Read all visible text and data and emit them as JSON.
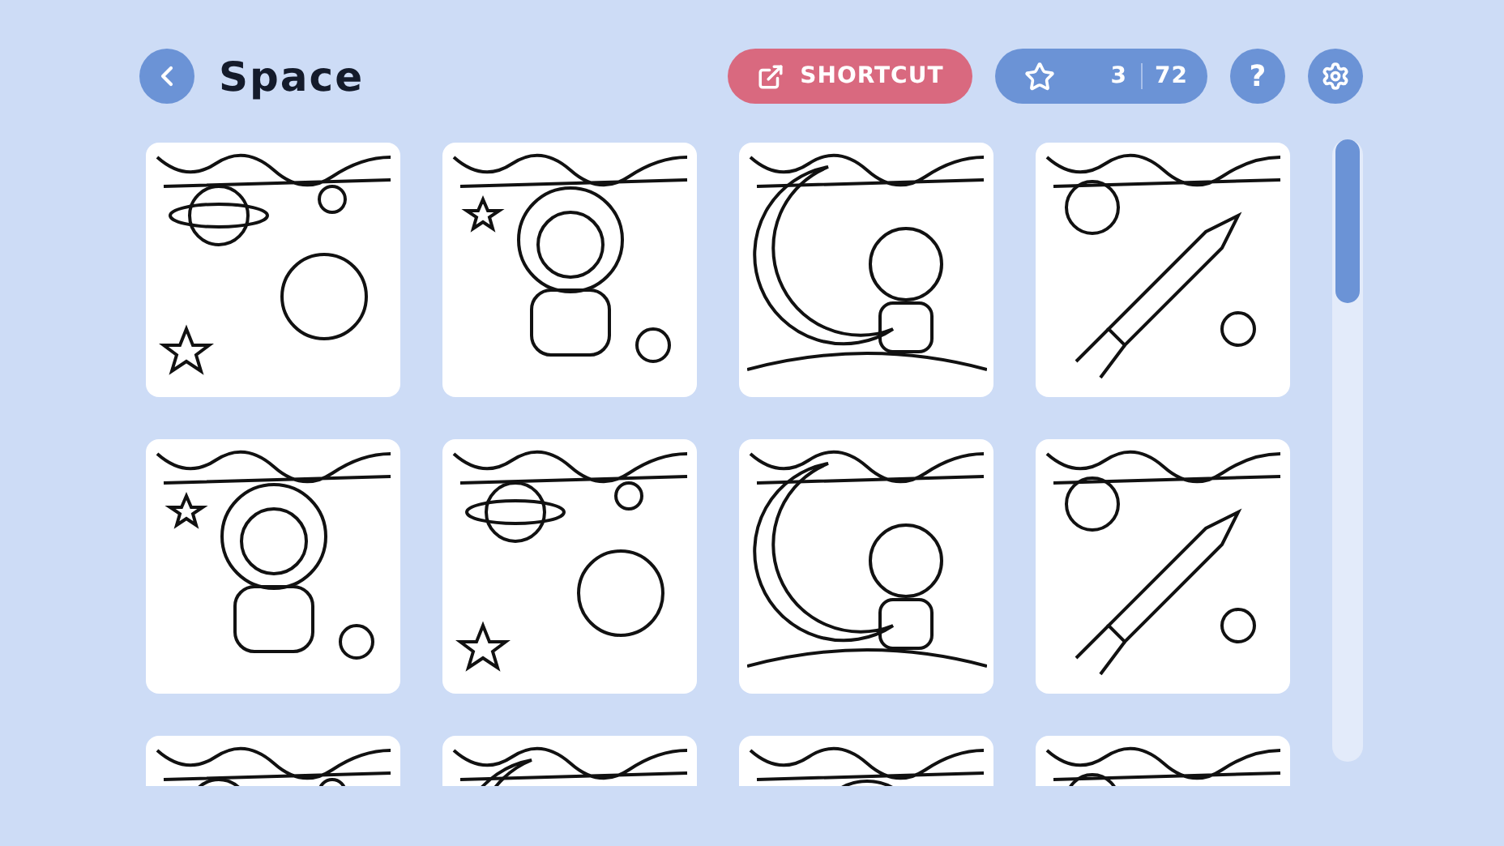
{
  "header": {
    "title": "Space",
    "shortcut": "SHORTCUT",
    "progress": {
      "done": "3",
      "total": "72"
    },
    "help": "?"
  },
  "pages": [
    {
      "kind": "planets"
    },
    {
      "kind": "astronaut"
    },
    {
      "kind": "moon"
    },
    {
      "kind": "rocket"
    },
    {
      "kind": "astronaut"
    },
    {
      "kind": "planets"
    },
    {
      "kind": "moon"
    },
    {
      "kind": "rocket"
    },
    {
      "kind": "planets"
    },
    {
      "kind": "moon"
    },
    {
      "kind": "astronaut"
    },
    {
      "kind": "rocket"
    }
  ]
}
